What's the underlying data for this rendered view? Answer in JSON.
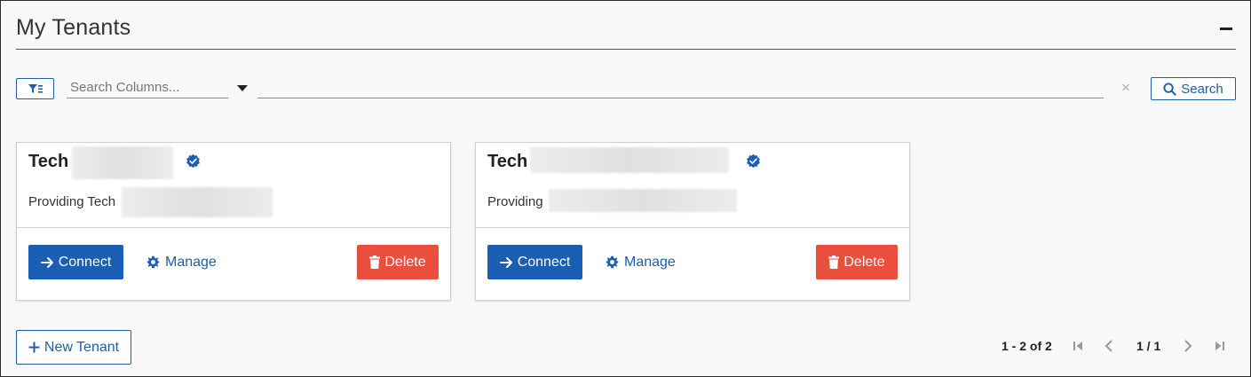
{
  "header": {
    "title": "My Tenants",
    "collapse_icon": "minus-icon"
  },
  "toolbar": {
    "filter_icon": "filter-list-icon",
    "search_columns_placeholder": "Search Columns...",
    "dropdown_icon": "caret-down-icon",
    "search_value": "",
    "clear_icon": "close-icon",
    "clear_symbol": "×",
    "search_label": "Search",
    "search_icon": "search-icon"
  },
  "tenants": [
    {
      "title": "Tech",
      "verified_icon": "verified-badge-icon",
      "subtitle": "Providing Tech",
      "connect_label": "Connect",
      "manage_label": "Manage",
      "delete_label": "Delete"
    },
    {
      "title": "Tech",
      "verified_icon": "verified-badge-icon",
      "subtitle": "Providing",
      "connect_label": "Connect",
      "manage_label": "Manage",
      "delete_label": "Delete"
    }
  ],
  "footer": {
    "new_tenant_label": "New Tenant",
    "range_text": "1 - 2 of 2",
    "page_text": "1 / 1"
  },
  "colors": {
    "primary": "#1a5fb4",
    "danger": "#ea4f3d",
    "verified": "#1a5fb4"
  }
}
